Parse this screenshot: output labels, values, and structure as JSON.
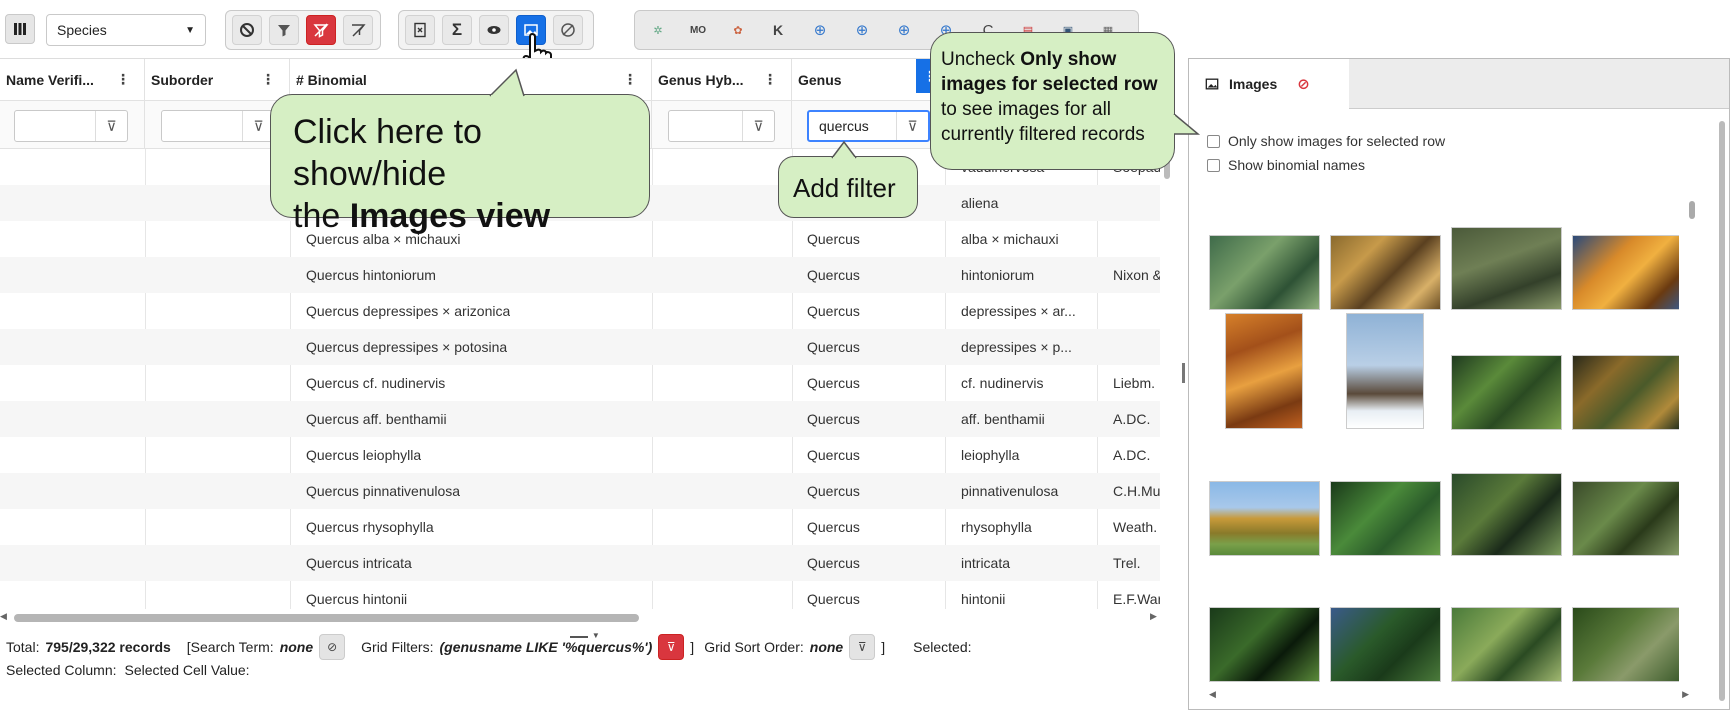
{
  "toolbar": {
    "species_select": "Species",
    "external_icons": [
      "gbif-icon",
      "mo-icon",
      "inat-icon",
      "k-icon",
      "globe-icon",
      "globe-icon",
      "globe-icon",
      "globe-icon",
      "c-icon",
      "card-icon",
      "image-icon",
      "map-icon"
    ]
  },
  "grid": {
    "columns": [
      "Name Verifi...",
      "Suborder",
      "# Binomial",
      "Genus Hyb...",
      "Genus",
      "",
      ""
    ],
    "genus_filter_value": "quercus",
    "rows": [
      {
        "binomial": "",
        "genus": "",
        "epithet": "vaudinervosa",
        "author": "Soepad"
      },
      {
        "binomial": "",
        "genus": "",
        "epithet": "aliena",
        "author": ""
      },
      {
        "binomial": "Quercus alba × michauxi",
        "genus": "Quercus",
        "epithet": "alba × michauxi",
        "author": ""
      },
      {
        "binomial": "Quercus hintoniorum",
        "genus": "Quercus",
        "epithet": "hintoniorum",
        "author": "Nixon &"
      },
      {
        "binomial": "Quercus depressipes × arizonica",
        "genus": "Quercus",
        "epithet": "depressipes × ar...",
        "author": ""
      },
      {
        "binomial": "Quercus depressipes × potosina",
        "genus": "Quercus",
        "epithet": "depressipes × p...",
        "author": ""
      },
      {
        "binomial": "Quercus cf. nudinervis",
        "genus": "Quercus",
        "epithet": "cf. nudinervis",
        "author": "Liebm."
      },
      {
        "binomial": "Quercus aff. benthamii",
        "genus": "Quercus",
        "epithet": "aff. benthamii",
        "author": "A.DC."
      },
      {
        "binomial": "Quercus leiophylla",
        "genus": "Quercus",
        "epithet": "leiophylla",
        "author": "A.DC."
      },
      {
        "binomial": "Quercus pinnativenulosa",
        "genus": "Quercus",
        "epithet": "pinnativenulosa",
        "author": "C.H.Mul"
      },
      {
        "binomial": "Quercus rhysophylla",
        "genus": "Quercus",
        "epithet": "rhysophylla",
        "author": "Weath."
      },
      {
        "binomial": "Quercus intricata",
        "genus": "Quercus",
        "epithet": "intricata",
        "author": "Trel."
      },
      {
        "binomial": "Quercus hintonii",
        "genus": "Quercus",
        "epithet": "hintonii",
        "author": "E.F.Warl"
      }
    ]
  },
  "status": {
    "total_label": "Total:",
    "total_value": "795/29,322 records",
    "search_label": "[Search Term:",
    "search_value": "none",
    "filters_label": "Grid Filters:",
    "filters_value": "(genusname LIKE '%quercus%')",
    "filters_close": "]",
    "sort_label": "Grid Sort Order:",
    "sort_value": "none",
    "sort_close": "]",
    "selected_label": "Selected:",
    "selected_column_label": "Selected Column:",
    "selected_cell_label": "Selected Cell Value:"
  },
  "images_panel": {
    "tab_label": "Images",
    "option1": "Only show images for selected row",
    "option2": "Show binomial names"
  },
  "callouts": {
    "images_view_line1": "Click here to show/hide",
    "images_view_line2_prefix": "the ",
    "images_view_line2_bold": "Images view",
    "add_filter": "Add filter",
    "uncheck_prefix": "Uncheck ",
    "uncheck_bold": "Only show images for selected row",
    "uncheck_suffix": " to see images for all currently filtered records"
  },
  "colors": {
    "accent_blue": "#1670e6",
    "filter_red": "#d9363e",
    "callout_green": "#d6efc4"
  }
}
